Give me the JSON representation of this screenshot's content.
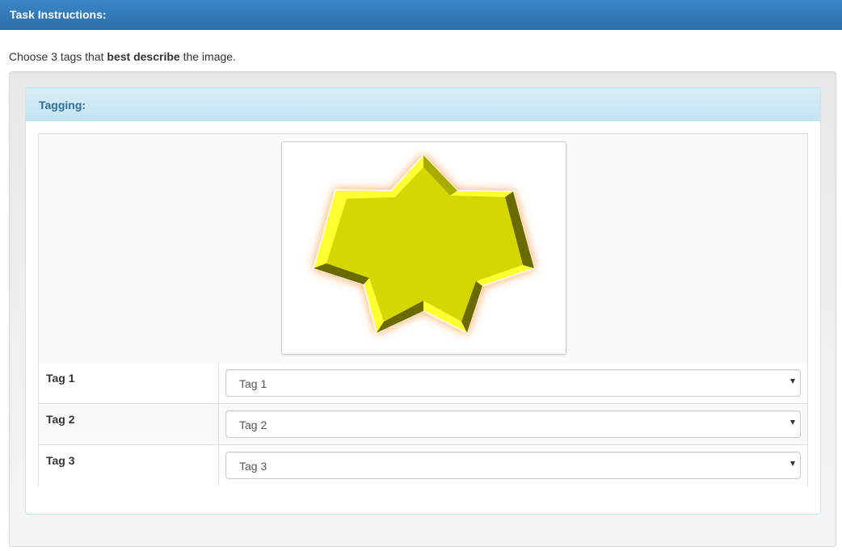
{
  "header": {
    "title": "Task Instructions:"
  },
  "instructions": {
    "prefix": "Choose 3 tags that ",
    "emphasis": "best describe",
    "suffix": " the image."
  },
  "panel": {
    "title": "Tagging:"
  },
  "image": {
    "icon": "seven-pointed-star-icon",
    "fill_color": "#d4d800",
    "highlight_color": "#ffff33",
    "shadow_color": "#6b6b00",
    "glow_color": "#ff9a3c"
  },
  "tags": [
    {
      "label": "Tag 1",
      "selected": "Tag 1"
    },
    {
      "label": "Tag 2",
      "selected": "Tag 2"
    },
    {
      "label": "Tag 3",
      "selected": "Tag 3"
    }
  ]
}
